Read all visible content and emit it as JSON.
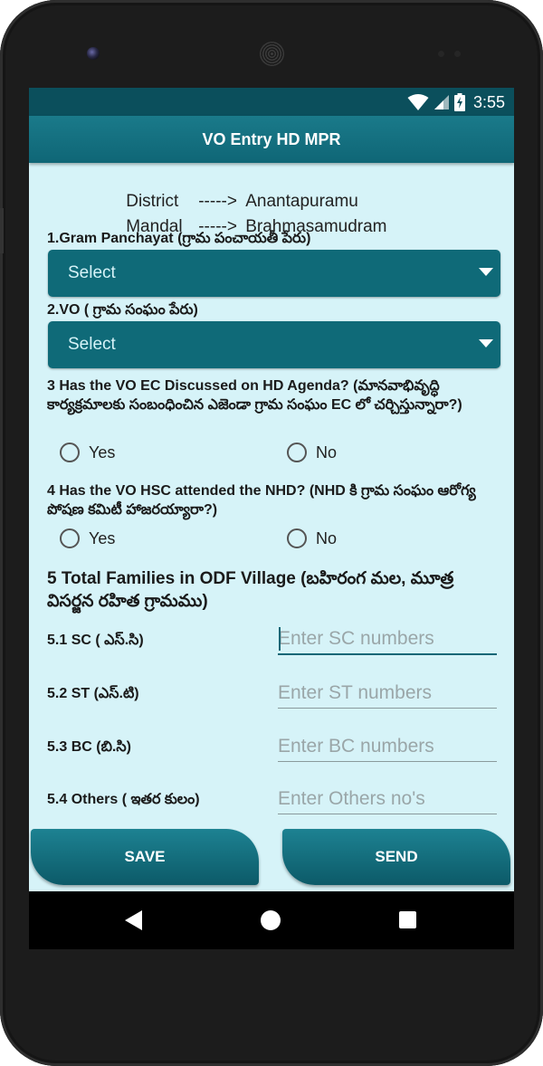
{
  "status": {
    "time": "3:55"
  },
  "appbar": {
    "title": "VO Entry HD MPR"
  },
  "location": {
    "district_key": "District",
    "district_arrow": "----->",
    "district_value": "Anantapuramu",
    "mandal_key": "Mandal",
    "mandal_arrow": "----->",
    "mandal_value": "Brahmasamudram"
  },
  "q1": {
    "label": "1.Gram Panchayat  (గ్రామ పంచాయతీ పేరు)",
    "selected": "Select"
  },
  "q2": {
    "label": "2.VO ( గ్రామ సంఘం పేరు)",
    "selected": "Select"
  },
  "q3": {
    "label": "3 Has the VO EC Discussed on HD Agenda?  (మానవాభివృద్ధి కార్యక్రమాలకు సంబంధించిన ఎజెండా  గ్రామ సంఘం EC  లో చర్చిస్తున్నారా?)",
    "yes": "Yes",
    "no": "No"
  },
  "q4": {
    "label": "4 Has the VO HSC attended the NHD? (NHD కి  గ్రామ సంఘం ఆరోగ్య పోషణ కమిటీ హాజరయ్యారా?)",
    "yes": "Yes",
    "no": "No"
  },
  "q5": {
    "label": "5 Total Families in  ODF Village   (బహిరంగ మల, మూత్ర విసర్జన రహిత గ్రామము)",
    "sc_label": "5.1 SC ( ఎస్.సి)",
    "sc_placeholder": "Enter SC numbers",
    "st_label": "5.2 ST (ఎస్.టి)",
    "st_placeholder": "Enter ST numbers",
    "bc_label": "5.3  BC (బి.సి)",
    "bc_placeholder": "Enter BC numbers",
    "others_label": "5.4  Others ( ఇతర కులం)",
    "others_placeholder": "Enter Others no's"
  },
  "buttons": {
    "save": "SAVE",
    "send": "SEND"
  },
  "colors": {
    "primary": "#0f6676",
    "statusbar": "#0b4f5c",
    "background": "#d6f3f8"
  }
}
